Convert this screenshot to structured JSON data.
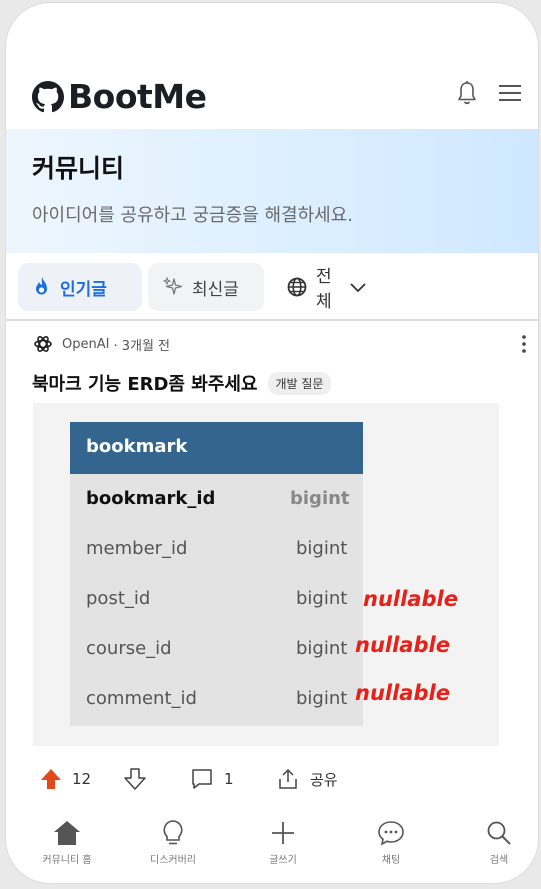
{
  "header": {
    "logo_text": "BootMe"
  },
  "banner": {
    "title": "커뮤니티",
    "subtitle": "아이디어를 공유하고 궁금증을 해결하세요."
  },
  "filters": {
    "popular": "인기글",
    "latest": "최신글",
    "all": "전체"
  },
  "post": {
    "author": "OpenAI",
    "time": "· 3개월 전",
    "title": "북마크 기능 ERD좀 봐주세요",
    "tag": "개발 질문",
    "erd": {
      "table_name": "bookmark",
      "rows": [
        {
          "column": "bookmark_id",
          "type": "bigint"
        },
        {
          "column": "member_id",
          "type": "bigint"
        },
        {
          "column": "post_id",
          "type": "bigint"
        },
        {
          "column": "course_id",
          "type": "bigint"
        },
        {
          "column": "comment_id",
          "type": "bigint"
        }
      ],
      "annotation": "nullable"
    },
    "upvotes": "12",
    "comments": "1",
    "share_label": "공유"
  },
  "nav": [
    {
      "label": "커뮤니티 홈"
    },
    {
      "label": "디스커버리"
    },
    {
      "label": "글쓰기"
    },
    {
      "label": "채팅"
    },
    {
      "label": "검색"
    }
  ],
  "colors": {
    "accent": "#1d6fe0",
    "upvote": "#e04a1a",
    "erd_header": "#33658f",
    "nullable": "#e8201a"
  }
}
